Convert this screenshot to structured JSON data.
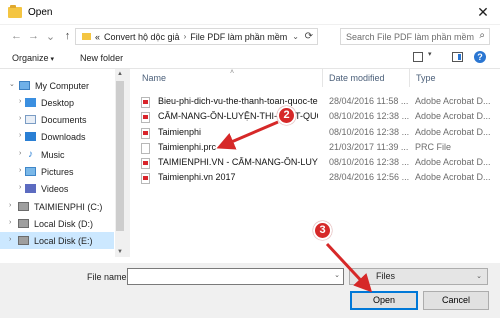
{
  "window": {
    "title": "Open",
    "close_glyph": "✕"
  },
  "nav": {
    "back_glyph": "←",
    "forward_glyph": "→",
    "recent_glyph": "⌄",
    "up_glyph": "↑",
    "path_prefix": "«",
    "path": [
      "Convert hộ dộc giả",
      "File PDF làm phần mềm"
    ],
    "separator": "›",
    "search_placeholder": "Search File PDF làm phần mềm"
  },
  "toolbar": {
    "organize_label": "Organize",
    "new_folder_label": "New folder",
    "help_label": "?"
  },
  "sidebar": {
    "items": [
      {
        "label": "My Computer",
        "icon": "computer-icon",
        "level": 0
      },
      {
        "label": "Desktop",
        "icon": "desktop-icon",
        "level": 1
      },
      {
        "label": "Documents",
        "icon": "documents-icon",
        "level": 1
      },
      {
        "label": "Downloads",
        "icon": "downloads-icon",
        "level": 1
      },
      {
        "label": "Music",
        "icon": "music-icon",
        "level": 1
      },
      {
        "label": "Pictures",
        "icon": "pictures-icon",
        "level": 1
      },
      {
        "label": "Videos",
        "icon": "videos-icon",
        "level": 1
      },
      {
        "label": "TAIMIENPHI (C:)",
        "icon": "drive-icon",
        "level": 1
      },
      {
        "label": "Local Disk (D:)",
        "icon": "drive-icon",
        "level": 1
      },
      {
        "label": "Local Disk (E:)",
        "icon": "drive-icon",
        "level": 1,
        "selected": true
      }
    ]
  },
  "columns": {
    "name": "Name",
    "date": "Date modified",
    "type": "Type"
  },
  "files": [
    {
      "name": "Bieu-phi-dich-vu-the-thanh-toan-quoc-te",
      "date": "28/04/2016 11:58 ...",
      "type": "Adobe Acrobat D...",
      "kind": "pdf"
    },
    {
      "name": "CẨM-NANG-ÔN-LUYỆN-THI-THPT-QUỐ...",
      "date": "08/10/2016 12:38 ...",
      "type": "Adobe Acrobat D...",
      "kind": "pdf"
    },
    {
      "name": "Taimienphi",
      "date": "08/10/2016 12:38 ...",
      "type": "Adobe Acrobat D...",
      "kind": "pdf"
    },
    {
      "name": "Taimienphi.prc",
      "date": "21/03/2017 11:39 ...",
      "type": "PRC File",
      "kind": "file"
    },
    {
      "name": "TAIMIENPHI.VN - CẨM-NANG-ÔN-LUYỆ...",
      "date": "08/10/2016 12:38 ...",
      "type": "Adobe Acrobat D...",
      "kind": "pdf"
    },
    {
      "name": "Taimienphi.vn 2017",
      "date": "28/04/2016 12:56 ...",
      "type": "Adobe Acrobat D...",
      "kind": "pdf"
    }
  ],
  "bottom": {
    "file_name_label": "File name:",
    "file_name_value": "",
    "file_type": "Files",
    "open_label": "Open",
    "cancel_label": "Cancel"
  },
  "annotations": [
    {
      "label": "2",
      "color": "#d62828"
    },
    {
      "label": "3",
      "color": "#d62828"
    }
  ]
}
